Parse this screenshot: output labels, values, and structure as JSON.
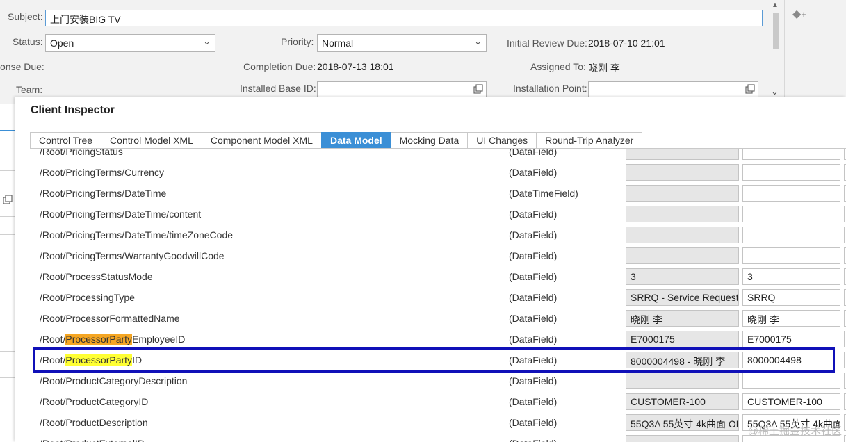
{
  "form": {
    "subject_label": "Subject:",
    "subject_value": "上门安装BIG TV",
    "status_label": "Status:",
    "status_value": "Open",
    "priority_label": "Priority:",
    "priority_value": "Normal",
    "initial_review_label": "Initial Review Due:",
    "initial_review_value": "2018-07-10 21:01",
    "response_due_label": "onse Due:",
    "completion_due_label": "Completion Due:",
    "completion_due_value": "2018-07-13 18:01",
    "assigned_to_label": "Assigned To:",
    "assigned_to_value": "晓刚 李",
    "team_label": "Team:",
    "installed_base_label": "Installed Base ID:",
    "installed_base_value": "",
    "installation_point_label": "Installation Point:",
    "installation_point_value": ""
  },
  "inspector": {
    "title": "Client Inspector",
    "tabs": [
      {
        "label": "Control Tree",
        "active": false
      },
      {
        "label": "Control Model XML",
        "active": false
      },
      {
        "label": "Component Model XML",
        "active": false
      },
      {
        "label": "Data Model",
        "active": true
      },
      {
        "label": "Mocking Data",
        "active": false
      },
      {
        "label": "UI Changes",
        "active": false
      },
      {
        "label": "Round-Trip Analyzer",
        "active": false
      }
    ],
    "rows": [
      {
        "path": "/Root/PricingStatus",
        "type": "(DataField)",
        "v1": "",
        "v2": ""
      },
      {
        "path": "/Root/PricingTerms/Currency",
        "type": "(DataField)",
        "v1": "",
        "v2": ""
      },
      {
        "path": "/Root/PricingTerms/DateTime",
        "type": "(DateTimeField)",
        "v1": "",
        "v2": ""
      },
      {
        "path": "/Root/PricingTerms/DateTime/content",
        "type": "(DataField)",
        "v1": "",
        "v2": ""
      },
      {
        "path": "/Root/PricingTerms/DateTime/timeZoneCode",
        "type": "(DataField)",
        "v1": "",
        "v2": ""
      },
      {
        "path": "/Root/PricingTerms/WarrantyGoodwillCode",
        "type": "(DataField)",
        "v1": "",
        "v2": ""
      },
      {
        "path": "/Root/ProcessStatusMode",
        "type": "(DataField)",
        "v1": "3",
        "v2": "3"
      },
      {
        "path": "/Root/ProcessingType",
        "type": "(DataField)",
        "v1": "SRRQ - Service Request",
        "v2": "SRRQ"
      },
      {
        "path": "/Root/ProcessorFormattedName",
        "type": "(DataField)",
        "v1": "晓刚 李",
        "v2": "晓刚 李"
      },
      {
        "path_pre": "/Root/",
        "path_hl": "ProcessorParty",
        "path_post": "EmployeeID",
        "hl": "orange",
        "type": "(DataField)",
        "v1": "E7000175",
        "v2": "E7000175"
      },
      {
        "path_pre": "/Root/",
        "path_hl": "ProcessorParty",
        "path_post": "ID",
        "hl": "yellow",
        "selected": true,
        "type": "(DataField)",
        "v1": "8000004498 - 晓刚 李",
        "v2": "8000004498"
      },
      {
        "path": "/Root/ProductCategoryDescription",
        "type": "(DataField)",
        "v1": "",
        "v2": ""
      },
      {
        "path": "/Root/ProductCategoryID",
        "type": "(DataField)",
        "v1": "CUSTOMER-100",
        "v2": "CUSTOMER-100"
      },
      {
        "path": "/Root/ProductDescription",
        "type": "(DataField)",
        "v1": "55Q3A 55英寸 4k曲面 OL",
        "v2": "55Q3A 55英寸 4k曲面"
      },
      {
        "path": "/Root/ProductExternalID",
        "type": "(DataField)",
        "v1": "",
        "v2": ""
      }
    ]
  },
  "watermark": "@稀土掘金技术社区",
  "colors": {
    "accent": "#3b8fd6",
    "selection_box": "#1010b8",
    "highlight_orange": "#f5a623",
    "highlight_yellow": "#ffff33"
  }
}
